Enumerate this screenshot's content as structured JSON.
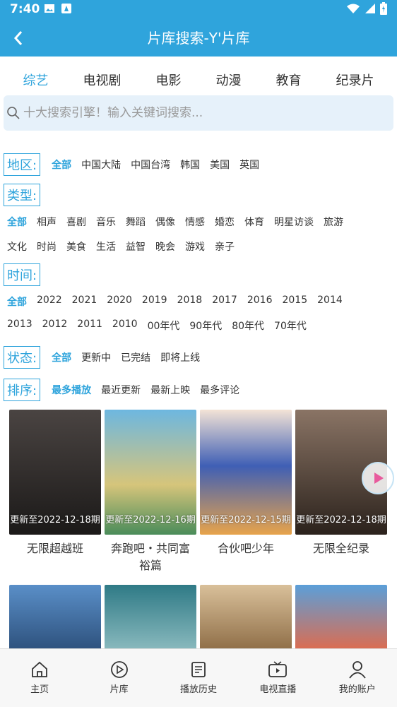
{
  "status": {
    "time": "7:40"
  },
  "header": {
    "title": "片库搜索-Y'片库"
  },
  "tabs": [
    {
      "label": "综艺",
      "active": true
    },
    {
      "label": "电视剧"
    },
    {
      "label": "电影"
    },
    {
      "label": "动漫"
    },
    {
      "label": "教育"
    },
    {
      "label": "纪录片"
    }
  ],
  "search": {
    "placeholder": "十大搜索引擎！输入关键词搜索..."
  },
  "filters": {
    "region": {
      "label": "地区:",
      "options": [
        "全部",
        "中国大陆",
        "中国台湾",
        "韩国",
        "美国",
        "英国"
      ]
    },
    "type": {
      "label": "类型:",
      "options_line1": [
        "全部",
        "相声",
        "喜剧",
        "音乐",
        "舞蹈",
        "偶像",
        "情感",
        "婚恋",
        "体育",
        "明星访谈",
        "旅游"
      ],
      "options_line2": [
        "文化",
        "时尚",
        "美食",
        "生活",
        "益智",
        "晚会",
        "游戏",
        "亲子"
      ]
    },
    "time": {
      "label": "时间:",
      "options_line1": [
        "全部",
        "2022",
        "2021",
        "2020",
        "2019",
        "2018",
        "2017",
        "2016",
        "2015",
        "2014"
      ],
      "options_line2": [
        "2013",
        "2012",
        "2011",
        "2010",
        "00年代",
        "90年代",
        "80年代",
        "70年代"
      ]
    },
    "state": {
      "label": "状态:",
      "options": [
        "全部",
        "更新中",
        "已完结",
        "即将上线"
      ]
    },
    "sort": {
      "label": "排序:",
      "options": [
        "最多播放",
        "最近更新",
        "最新上映",
        "最多评论"
      ]
    }
  },
  "cards": [
    {
      "title": "无限超越班",
      "update": "更新至2022-12-18期",
      "color1": "#3a3533",
      "color2": "#1b1918"
    },
    {
      "title": "奔跑吧・共同富裕篇",
      "update": "更新至2022-12-16期",
      "color1": "#6db7e0",
      "color2": "#d6c57b"
    },
    {
      "title": "合伙吧少年",
      "update": "更新至2022-12-15期",
      "color1": "#f3b6b0",
      "color2": "#3f5fb5"
    },
    {
      "title": "无限全纪录",
      "update": "更新至2022-12-18期",
      "color1": "#5c4a40",
      "color2": "#2b221c"
    }
  ],
  "cards_row2": [
    {
      "color1": "#5a8fc8",
      "color2": "#2c4f7a"
    },
    {
      "color1": "#2f7a86",
      "color2": "#8dbcc0"
    },
    {
      "color1": "#c9a97b",
      "color2": "#8c6b44"
    },
    {
      "color1": "#5b9fd9",
      "color2": "#e26a4a"
    }
  ],
  "bottom_nav": [
    {
      "label": "主页"
    },
    {
      "label": "片库"
    },
    {
      "label": "播放历史"
    },
    {
      "label": "电视直播"
    },
    {
      "label": "我的账户"
    }
  ],
  "colors": {
    "accent": "#2fa4dc"
  }
}
